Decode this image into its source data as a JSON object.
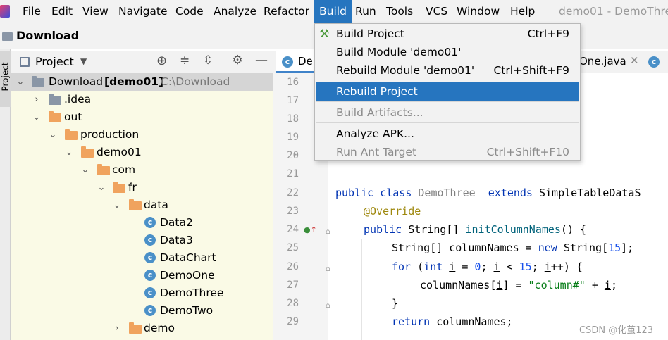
{
  "menubar": {
    "items": [
      "File",
      "Edit",
      "View",
      "Navigate",
      "Code",
      "Analyze",
      "Refactor",
      "Build",
      "Run",
      "Tools",
      "VCS",
      "Window",
      "Help"
    ],
    "window_title": "demo01 - DemoThre"
  },
  "breadcrumb": {
    "label": "Download"
  },
  "sidebar_stripe": {
    "label": "Project"
  },
  "project_panel": {
    "view_label": "Project"
  },
  "tree": {
    "root_name": "Download",
    "root_module": "[demo01]",
    "root_path": "C:\\Download",
    "nodes": [
      ".idea",
      "out",
      "production",
      "demo01",
      "com",
      "fr",
      "data",
      "Data2",
      "Data3",
      "DataChart",
      "DemoOne",
      "DemoThree",
      "DemoTwo",
      "demo"
    ]
  },
  "editor": {
    "tabs": [
      "De",
      "One.java"
    ],
    "line_numbers": [
      "16",
      "17",
      "18",
      "19",
      "20",
      "21",
      "22",
      "23",
      "24",
      "25",
      "26",
      "27",
      "28",
      "29"
    ],
    "code": {
      "l22_kw": "public class ",
      "l22_name": "DemoThree",
      "l22_ext": "  extends ",
      "l22_rest": "SimpleTableDataS",
      "l23": "@Override",
      "l24_kw": "public ",
      "l24_type": "String[] ",
      "l24_m": "initColumnNames",
      "l24_rest": "() {",
      "l25_a": "String[] columnNames = ",
      "l25_new": "new ",
      "l25_b": "String[",
      "l25_num": "15",
      "l25_c": "];",
      "l26_for": "for ",
      "l26_a": "(",
      "l26_int": "int ",
      "l26_i": "i",
      "l26_b": " = ",
      "l26_z": "0",
      "l26_c": "; ",
      "l26_i2": "i",
      "l26_d": " < ",
      "l26_15": "15",
      "l26_e": "; ",
      "l26_i3": "i",
      "l26_f": "++) {",
      "l27_a": "columnNames[",
      "l27_i": "i",
      "l27_b": "] = ",
      "l27_str": "\"column#\"",
      "l27_c": " + ",
      "l27_i2": "i",
      "l27_d": ";",
      "l28": "}",
      "l29_ret": "return ",
      "l29_rest": "columnNames;"
    }
  },
  "build_menu": {
    "items": [
      {
        "label": "Build Project",
        "shortcut": "Ctrl+F9"
      },
      {
        "label": "Build Module 'demo01'",
        "shortcut": ""
      },
      {
        "label": "Rebuild Module 'demo01'",
        "shortcut": "Ctrl+Shift+F9"
      },
      {
        "label": "Rebuild Project",
        "shortcut": ""
      },
      {
        "label": "Build Artifacts...",
        "shortcut": ""
      },
      {
        "label": "Analyze APK...",
        "shortcut": ""
      },
      {
        "label": "Run Ant Target",
        "shortcut": "Ctrl+Shift+F10"
      }
    ]
  },
  "watermark": "CSDN @化茧123",
  "colors": {
    "accent": "#2675bf",
    "folder": "#f0a35e",
    "tree_bg": "#fafae6",
    "keyword": "#0033b3",
    "annotation": "#9e880d",
    "string": "#067d17",
    "number": "#1750eb"
  }
}
